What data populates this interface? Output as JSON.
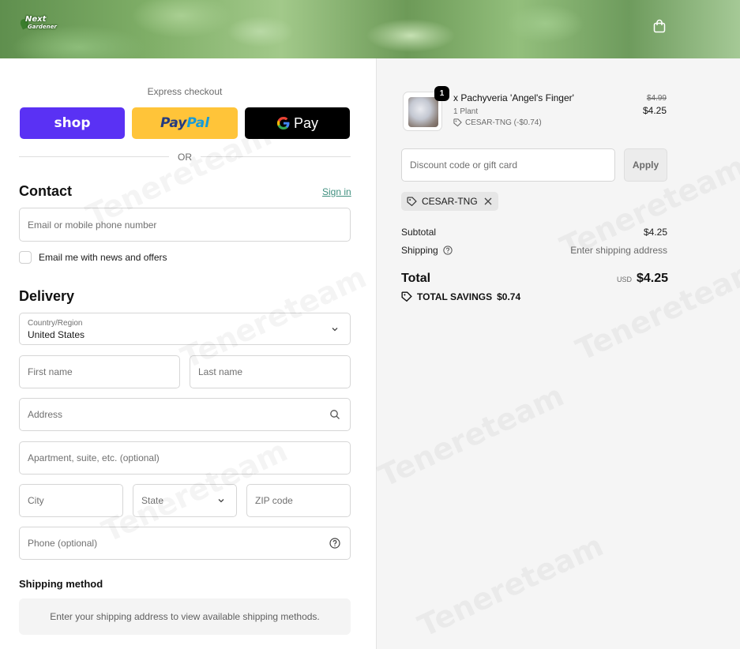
{
  "header": {
    "logo_line1": "Next",
    "logo_line2": "Gardener"
  },
  "express": {
    "title": "Express checkout",
    "shop_label": "shop",
    "paypal_label_1": "Pay",
    "paypal_label_2": "Pal",
    "gpay_label": "Pay",
    "or_text": "OR"
  },
  "contact": {
    "heading": "Contact",
    "sign_in": "Sign in",
    "email_placeholder": "Email or mobile phone number",
    "newsletter_label": "Email me with news and offers"
  },
  "delivery": {
    "heading": "Delivery",
    "country_label": "Country/Region",
    "country_value": "United States",
    "first_name": "First name",
    "last_name": "Last name",
    "address": "Address",
    "apartment": "Apartment, suite, etc. (optional)",
    "city": "City",
    "state": "State",
    "zip": "ZIP code",
    "phone": "Phone (optional)"
  },
  "shipping_method": {
    "heading": "Shipping method",
    "empty_text": "Enter your shipping address to view available shipping methods."
  },
  "order": {
    "item": {
      "quantity": "1",
      "name": "x Pachyveria 'Angel's Finger'",
      "variant": "1 Plant",
      "discount": "CESAR-TNG (-$0.74)",
      "price_original": "$4.99",
      "price_current": "$4.25"
    },
    "discount_placeholder": "Discount code or gift card",
    "apply_label": "Apply",
    "applied_code": "CESAR-TNG",
    "subtotal_label": "Subtotal",
    "subtotal_value": "$4.25",
    "shipping_label": "Shipping",
    "shipping_value": "Enter shipping address",
    "total_label": "Total",
    "currency": "USD",
    "total_value": "$4.25",
    "savings_label": "TOTAL SAVINGS",
    "savings_value": "$0.74"
  },
  "watermark": "Tenereteam",
  "colors": {
    "shop": "#5a31f4",
    "paypal": "#ffc439",
    "gpay": "#000000",
    "link": "#3f8f7f",
    "sidebar_bg": "#f5f5f5"
  }
}
